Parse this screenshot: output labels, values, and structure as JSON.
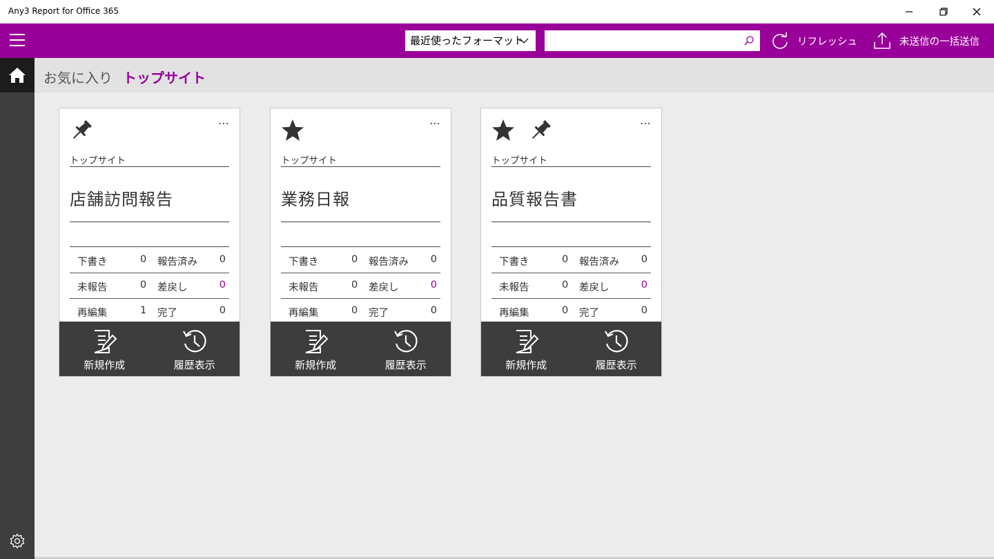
{
  "window": {
    "title": "Any3 Report for Office 365",
    "controls": [
      "minimize-icon",
      "restore-icon",
      "close-icon"
    ]
  },
  "colors": {
    "accent": "#990099",
    "sidebar": "#3e3e3e",
    "card_footer": "#3d3d3d"
  },
  "toolbar": {
    "format_select": "最近使ったフォーマット",
    "search_value": "",
    "search_placeholder": "",
    "refresh_label": "リフレッシュ",
    "send_all_label": "未送信の一括送信"
  },
  "tabs": [
    {
      "label": "お気に入り",
      "active": false
    },
    {
      "label": "トップサイト",
      "active": true
    }
  ],
  "cards": [
    {
      "icons": [
        "pin-icon"
      ],
      "site": "トップサイト",
      "name": "店舗訪問報告",
      "stats": {
        "draft_label": "下書き",
        "draft": "0",
        "reported_label": "報告済み",
        "reported": "0",
        "unreported_label": "未報告",
        "unreported": "0",
        "returned_label": "差戻し",
        "returned": "0",
        "reedit_label": "再編集",
        "reedit": "1",
        "done_label": "完了",
        "done": "0"
      },
      "new_label": "新規作成",
      "history_label": "履歴表示"
    },
    {
      "icons": [
        "star-icon"
      ],
      "site": "トップサイト",
      "name": "業務日報",
      "stats": {
        "draft_label": "下書き",
        "draft": "0",
        "reported_label": "報告済み",
        "reported": "0",
        "unreported_label": "未報告",
        "unreported": "0",
        "returned_label": "差戻し",
        "returned": "0",
        "reedit_label": "再編集",
        "reedit": "0",
        "done_label": "完了",
        "done": "0"
      },
      "new_label": "新規作成",
      "history_label": "履歴表示"
    },
    {
      "icons": [
        "star-icon",
        "pin-icon"
      ],
      "site": "トップサイト",
      "name": "品質報告書",
      "stats": {
        "draft_label": "下書き",
        "draft": "0",
        "reported_label": "報告済み",
        "reported": "0",
        "unreported_label": "未報告",
        "unreported": "0",
        "returned_label": "差戻し",
        "returned": "0",
        "reedit_label": "再編集",
        "reedit": "0",
        "done_label": "完了",
        "done": "0"
      },
      "new_label": "新規作成",
      "history_label": "履歴表示"
    }
  ]
}
